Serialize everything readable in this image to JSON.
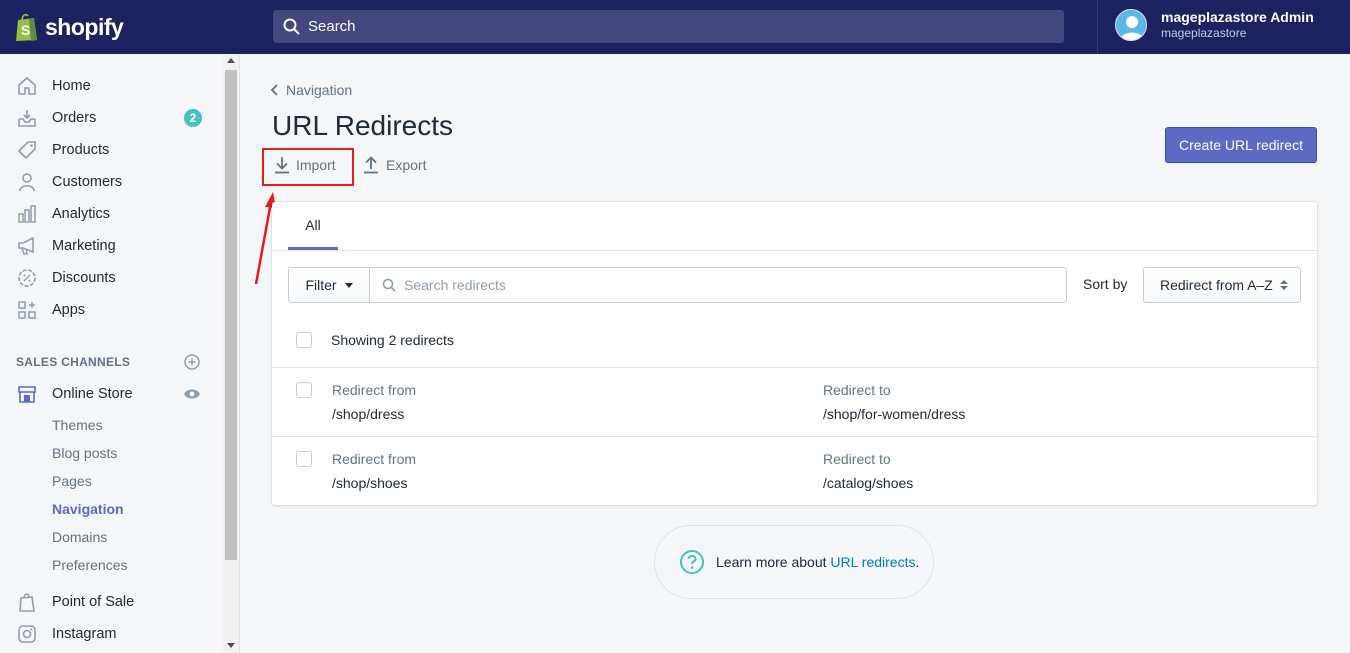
{
  "topbar": {
    "brand": "shopify",
    "search_placeholder": "Search",
    "user_name": "mageplazastore Admin",
    "user_store": "mageplazastore"
  },
  "sidebar": {
    "items": [
      {
        "label": "Home",
        "icon": "home-icon"
      },
      {
        "label": "Orders",
        "icon": "orders-icon",
        "badge": "2"
      },
      {
        "label": "Products",
        "icon": "tag-icon"
      },
      {
        "label": "Customers",
        "icon": "person-icon"
      },
      {
        "label": "Analytics",
        "icon": "bar-chart-icon"
      },
      {
        "label": "Marketing",
        "icon": "megaphone-icon"
      },
      {
        "label": "Discounts",
        "icon": "discount-icon"
      },
      {
        "label": "Apps",
        "icon": "apps-icon"
      }
    ],
    "sales_channels_title": "SALES CHANNELS",
    "online_store": "Online Store",
    "online_store_sub": [
      "Themes",
      "Blog posts",
      "Pages",
      "Navigation",
      "Domains",
      "Preferences"
    ],
    "active_sub": "Navigation",
    "point_of_sale": "Point of Sale",
    "instagram": "Instagram"
  },
  "main": {
    "breadcrumb": "Navigation",
    "title": "URL Redirects",
    "import_label": "Import",
    "export_label": "Export",
    "create_button": "Create URL redirect",
    "tab_all": "All",
    "filter_label": "Filter",
    "search_placeholder": "Search redirects",
    "sort_label": "Sort by",
    "sort_value": "Redirect from A–Z",
    "showing_text": "Showing 2 redirects",
    "rows": [
      {
        "from_label": "Redirect from",
        "from": "/shop/dress",
        "to_label": "Redirect to",
        "to": "/shop/for-women/dress"
      },
      {
        "from_label": "Redirect from",
        "from": "/shop/shoes",
        "to_label": "Redirect to",
        "to": "/catalog/shoes"
      }
    ],
    "learn_prefix": "Learn more about ",
    "learn_link": "URL redirects",
    "learn_suffix": "."
  },
  "colors": {
    "topbar": "#1c2260",
    "accent": "#5c6ac4",
    "badge": "#47c1bf",
    "highlight": "#e01f1f",
    "link": "#007ace"
  }
}
